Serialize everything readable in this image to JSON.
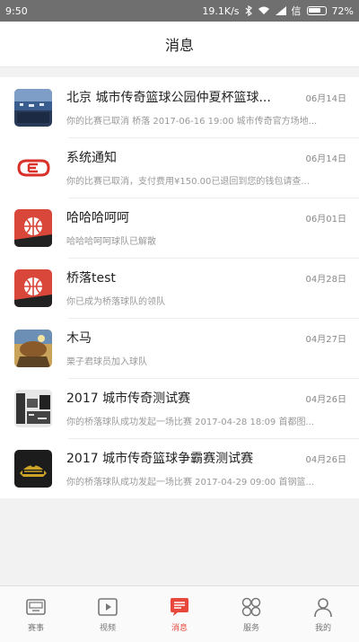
{
  "status": {
    "time": "9:50",
    "network_speed": "19.1K/s",
    "signal": "信",
    "battery": "72%"
  },
  "header": {
    "title": "消息"
  },
  "messages": [
    {
      "title": "北京 城市传奇篮球公园仲夏杯篮球...",
      "date": "06月14日",
      "preview": "你的比赛已取消 桥落 2017-06-16 19:00 城市传奇官方场地...",
      "avatar": "court-photo-icon"
    },
    {
      "title": "系统通知",
      "date": "06月14日",
      "preview": "你的比赛已取消，支付费用¥150.00已退回到您的钱包请查...",
      "avatar": "system-logo-icon"
    },
    {
      "title": "哈哈哈呵呵",
      "date": "06月01日",
      "preview": "哈哈哈呵呵球队已解散",
      "avatar": "team-ball-icon"
    },
    {
      "title": "桥落test",
      "date": "04月28日",
      "preview": "你已成为桥落球队的领队",
      "avatar": "team-ball-icon"
    },
    {
      "title": "木马",
      "date": "04月27日",
      "preview": "栗子君球员加入球队",
      "avatar": "horse-photo-icon"
    },
    {
      "title": "2017 城市传奇测试赛",
      "date": "04月26日",
      "preview": "你的桥落球队成功发起一场比赛 2017-04-28 18:09 首都图...",
      "avatar": "test-match-icon"
    },
    {
      "title": "2017 城市传奇篮球争霸赛测试赛",
      "date": "04月26日",
      "preview": "你的桥落球队成功发起一场比赛 2017-04-29 09:00 首钢篮...",
      "avatar": "crest-icon"
    }
  ],
  "tabs": [
    {
      "label": "赛事",
      "icon": "scoreboard-icon"
    },
    {
      "label": "视频",
      "icon": "play-icon"
    },
    {
      "label": "消息",
      "icon": "message-icon",
      "active": true
    },
    {
      "label": "服务",
      "icon": "grid-icon"
    },
    {
      "label": "我的",
      "icon": "person-icon"
    }
  ],
  "colors": {
    "accent": "#e8473b",
    "team_red": "#d9463a"
  }
}
